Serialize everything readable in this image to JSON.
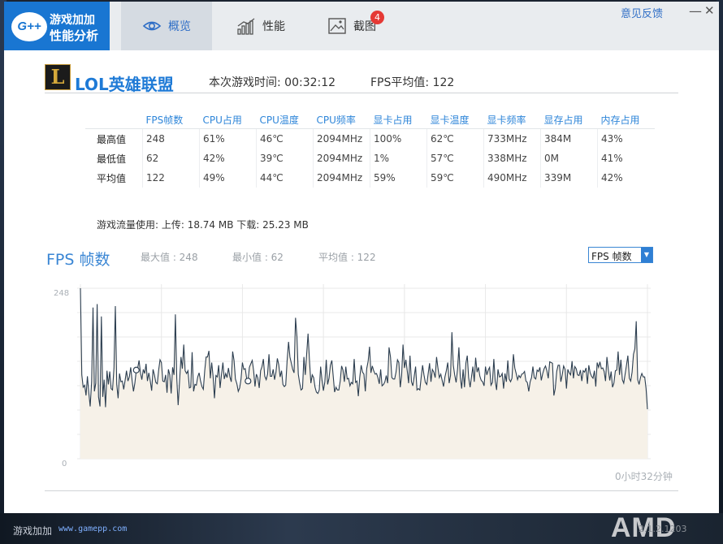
{
  "app": {
    "logo_text_line1": "游戏加加",
    "logo_text_line2": "性能分析",
    "logo_badge": "G++"
  },
  "tabs": [
    {
      "label": "概览",
      "icon": "eye-icon",
      "active": true
    },
    {
      "label": "性能",
      "icon": "bar-chart-icon",
      "active": false
    },
    {
      "label": "截图",
      "icon": "image-icon",
      "active": false,
      "badge": "4"
    }
  ],
  "window_controls": {
    "feedback": "意见反馈",
    "minimize": "—",
    "close": "✕"
  },
  "game": {
    "icon_letter": "L",
    "title": "LOL英雄联盟",
    "session_time": "本次游戏时间: 00:32:12",
    "fps_avg": "FPS平均值: 122"
  },
  "stats": {
    "columns": [
      "FPS帧数",
      "CPU占用",
      "CPU温度",
      "CPU频率",
      "显卡占用",
      "显卡温度",
      "显卡频率",
      "显存占用",
      "内存占用"
    ],
    "rows": [
      {
        "label": "最高值",
        "values": [
          "248",
          "61%",
          "46℃",
          "2094MHz",
          "100%",
          "62℃",
          "733MHz",
          "384M",
          "43%"
        ]
      },
      {
        "label": "最低值",
        "values": [
          "62",
          "42%",
          "39℃",
          "2094MHz",
          "1%",
          "57℃",
          "338MHz",
          "0M",
          "41%"
        ]
      },
      {
        "label": "平均值",
        "values": [
          "122",
          "49%",
          "44℃",
          "2094MHz",
          "59%",
          "59℃",
          "490MHz",
          "339M",
          "42%"
        ]
      }
    ]
  },
  "traffic": {
    "text": "游戏流量使用: 上传: 18.74 MB    下载: 25.23 MB"
  },
  "fps_panel": {
    "heading": "FPS 帧数",
    "max": "最大值 : 248",
    "min": "最小值 : 62",
    "avg": "平均值 : 122",
    "select_value": "FPS 帧数"
  },
  "chart_data": {
    "type": "area",
    "ylim": [
      0,
      248
    ],
    "y_tick_labels": [
      "248",
      "0"
    ],
    "x_end_label": "0小时32分钟",
    "grid": true,
    "color": "#2c3e50",
    "fill": "#f6f1e8",
    "values": [
      248,
      122,
      104,
      107,
      92,
      120,
      96,
      76,
      112,
      220,
      98,
      110,
      225,
      90,
      76,
      207,
      90,
      115,
      75,
      128,
      108,
      127,
      102,
      100,
      132,
      222,
      108,
      88,
      124,
      112,
      113,
      101,
      114,
      128,
      113,
      119,
      133,
      114,
      98,
      110,
      129,
      132,
      143,
      125,
      115,
      130,
      124,
      138,
      113,
      125,
      113,
      99,
      130,
      122,
      111,
      109,
      129,
      144,
      140,
      113,
      112,
      122,
      96,
      130,
      122,
      95,
      133,
      122,
      210,
      117,
      78,
      114,
      148,
      131,
      166,
      128,
      124,
      128,
      103,
      104,
      155,
      98,
      108,
      107,
      119,
      125,
      113,
      105,
      101,
      128,
      148,
      148,
      157,
      117,
      140,
      120,
      88,
      121,
      119,
      136,
      103,
      122,
      140,
      116,
      124,
      118,
      132,
      119,
      112,
      156,
      143,
      116,
      109,
      98,
      103,
      116,
      140,
      130,
      131,
      117,
      113,
      133,
      138,
      143,
      128,
      105,
      123,
      118,
      103,
      128,
      134,
      145,
      120,
      115,
      123,
      152,
      120,
      120,
      130,
      115,
      126,
      146,
      137,
      119,
      128,
      108,
      105,
      107,
      142,
      170,
      148,
      139,
      130,
      125,
      205,
      178,
      123,
      110,
      100,
      102,
      148,
      122,
      152,
      182,
      142,
      110,
      122,
      118,
      104,
      97,
      95,
      100,
      134,
      114,
      99,
      112,
      144,
      108,
      117,
      136,
      143,
      120,
      97,
      104,
      100,
      100,
      113,
      135,
      129,
      112,
      134,
      116,
      117,
      106,
      111,
      109,
      145,
      111,
      113,
      91,
      118,
      136,
      126,
      123,
      98,
      131,
      142,
      163,
      125,
      135,
      128,
      123,
      124,
      118,
      109,
      130,
      106,
      108,
      112,
      121,
      110,
      162,
      148,
      118,
      116,
      116,
      126,
      144,
      140,
      104,
      121,
      166,
      132,
      144,
      128,
      110,
      150,
      112,
      106,
      120,
      134,
      100,
      102,
      100,
      119,
      136,
      122,
      111,
      108,
      124,
      139,
      112,
      130,
      126,
      118,
      148,
      132,
      118,
      123,
      114,
      105,
      119,
      128,
      140,
      110,
      121,
      184,
      136,
      122,
      111,
      130,
      162,
      119,
      102,
      130,
      104,
      139,
      150,
      118,
      104,
      119,
      134,
      112,
      147,
      126,
      133,
      120,
      114,
      112,
      106,
      134,
      122,
      129,
      133,
      107,
      111,
      145,
      113,
      100,
      130,
      119,
      120,
      124,
      102,
      124,
      112,
      143,
      116,
      112,
      117,
      152,
      132,
      124,
      115,
      121,
      118,
      123,
      124,
      127,
      113,
      111,
      98,
      112,
      118,
      134,
      118,
      116,
      129,
      127,
      133,
      114,
      124,
      131,
      135,
      128,
      117,
      141,
      140,
      139,
      92,
      102,
      127,
      136,
      136,
      112,
      122,
      135,
      130,
      102,
      130,
      125,
      122,
      142,
      117,
      134,
      131,
      122,
      121,
      129,
      113,
      128,
      126,
      132,
      109,
      136,
      125,
      120,
      117,
      128,
      105,
      140,
      133,
      141,
      131,
      132,
      127,
      113,
      148,
      129,
      114,
      127,
      104,
      110,
      128,
      129,
      156,
      122,
      144,
      115,
      110,
      123,
      136,
      150,
      117,
      113,
      126,
      152,
      160,
      200,
      115,
      108,
      118,
      124,
      119,
      119,
      102,
      72
    ]
  },
  "footer": {
    "left_text": "游戏加加",
    "url": "www.gamepp.com",
    "brand": "AMD",
    "version": "2.1.2.1203"
  }
}
